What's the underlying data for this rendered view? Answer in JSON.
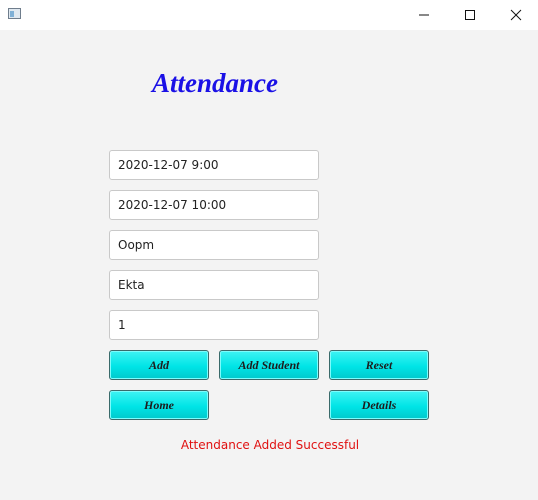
{
  "window": {
    "controls": {
      "minimize": "minimize",
      "maximize": "maximize",
      "close": "close"
    }
  },
  "heading": "Attendance",
  "fields": [
    {
      "value": "2020-12-07 9:00"
    },
    {
      "value": "2020-12-07 10:00"
    },
    {
      "value": "Oopm"
    },
    {
      "value": "Ekta"
    },
    {
      "value": "1"
    }
  ],
  "buttons": {
    "add": "Add",
    "add_student": "Add Student",
    "reset": "Reset",
    "home": "Home",
    "details": "Details"
  },
  "status_message": "Attendance Added Successful",
  "colors": {
    "heading": "#1a10e6",
    "button": "#00e4e6",
    "status": "#e01010"
  }
}
